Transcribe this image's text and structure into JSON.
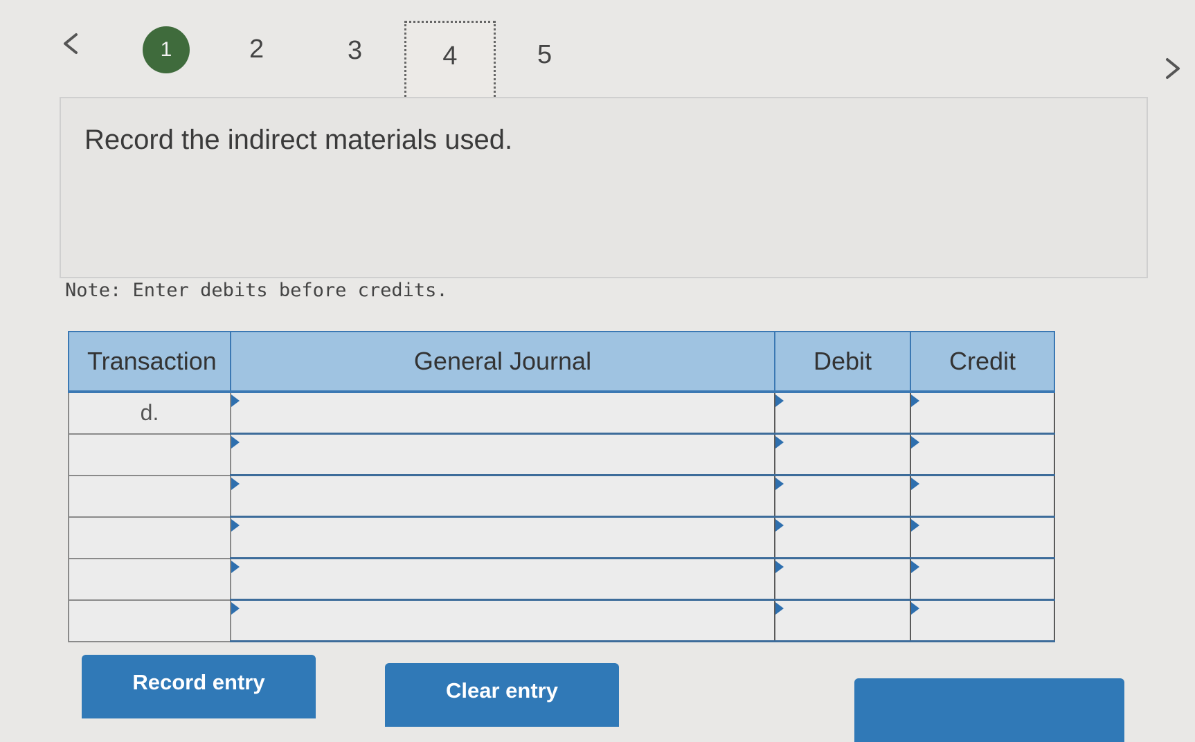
{
  "steps": [
    {
      "label": "1",
      "state": "done"
    },
    {
      "label": "2",
      "state": "pending"
    },
    {
      "label": "3",
      "state": "pending"
    },
    {
      "label": "4",
      "state": "current"
    },
    {
      "label": "5",
      "state": "pending"
    }
  ],
  "question": {
    "text": "Record the indirect materials used."
  },
  "note": "Note: Enter debits before credits.",
  "journal": {
    "headers": {
      "transaction": "Transaction",
      "general_journal": "General Journal",
      "debit": "Debit",
      "credit": "Credit"
    },
    "rows": [
      {
        "transaction": "d.",
        "account": "",
        "debit": "",
        "credit": ""
      },
      {
        "transaction": "",
        "account": "",
        "debit": "",
        "credit": ""
      },
      {
        "transaction": "",
        "account": "",
        "debit": "",
        "credit": ""
      },
      {
        "transaction": "",
        "account": "",
        "debit": "",
        "credit": ""
      },
      {
        "transaction": "",
        "account": "",
        "debit": "",
        "credit": ""
      },
      {
        "transaction": "",
        "account": "",
        "debit": "",
        "credit": ""
      }
    ]
  },
  "buttons": {
    "record": "Record entry",
    "clear": "Clear entry"
  },
  "colors": {
    "done_step": "#3f6b3c",
    "header_bg": "#9fc3e1",
    "button_bg": "#3079b7"
  }
}
